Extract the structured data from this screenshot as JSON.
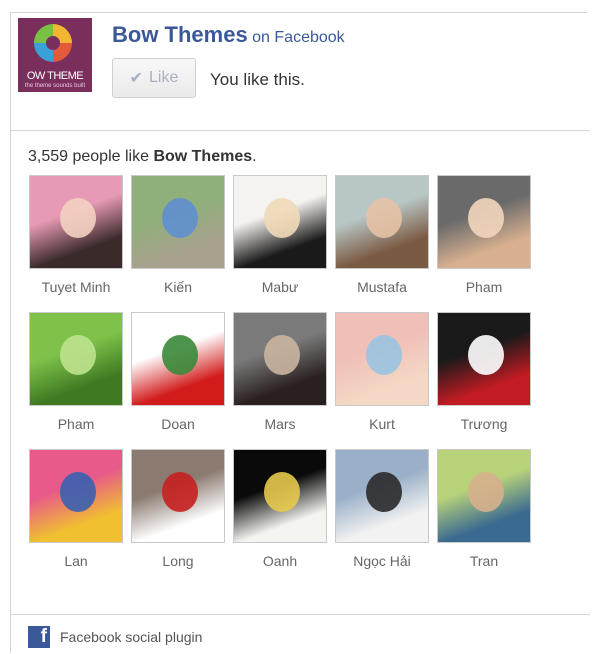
{
  "page": {
    "name": "Bow Themes",
    "on_text": "on Facebook",
    "like_button_label": "Like",
    "like_button_icon": "checkmark-icon",
    "like_status": "You like this.",
    "count_text": "3,559 people like ",
    "count_name": "Bow Themes",
    "count_suffix": ".",
    "logo_text": "OW THEME",
    "logo_subtext": "the theme sounds built"
  },
  "fans": [
    {
      "name": "Tuyet Minh",
      "colors": [
        "#e79ab5",
        "#3a2a2a",
        "#f3d2c1"
      ]
    },
    {
      "name": "Kiến",
      "colors": [
        "#8fb07a",
        "#a7a28d",
        "#5f8fd0"
      ]
    },
    {
      "name": "Mabư",
      "colors": [
        "#f5f3f0",
        "#1a1a1a",
        "#f1d9b8"
      ]
    },
    {
      "name": "Mustafa",
      "colors": [
        "#b8c7c6",
        "#7b5a43",
        "#e6c2a5"
      ]
    },
    {
      "name": "Pham",
      "colors": [
        "#6a6a6a",
        "#d8b08f",
        "#f2d6bd"
      ]
    },
    {
      "name": "Pham",
      "colors": [
        "#7ec24a",
        "#3f7a22",
        "#bde38e"
      ]
    },
    {
      "name": "Doan",
      "colors": [
        "#ffffff",
        "#d21c1c",
        "#3a8a3a"
      ]
    },
    {
      "name": "Mars",
      "colors": [
        "#7a7a7a",
        "#2a2020",
        "#c9b5a0"
      ]
    },
    {
      "name": "Kurt",
      "colors": [
        "#f0c0b8",
        "#f4d7c4",
        "#9ac3e0"
      ]
    },
    {
      "name": "Trương",
      "colors": [
        "#1a1a1a",
        "#c21b23",
        "#ffffff"
      ]
    },
    {
      "name": "Lan",
      "colors": [
        "#e85a8a",
        "#f0c030",
        "#3a60b0"
      ]
    },
    {
      "name": "Long",
      "colors": [
        "#8a7a70",
        "#ffffff",
        "#c52020"
      ]
    },
    {
      "name": "Oanh",
      "colors": [
        "#0a0a0a",
        "#f4f4f0",
        "#e6c94a"
      ]
    },
    {
      "name": "Ngọc Hải",
      "colors": [
        "#9ab0c8",
        "#f2f2f2",
        "#2a2a2a"
      ]
    },
    {
      "name": "Tran",
      "colors": [
        "#b8d27a",
        "#3a6a90",
        "#d7b08c"
      ]
    }
  ],
  "footer": {
    "label": "Facebook social plugin",
    "icon": "facebook-icon"
  }
}
